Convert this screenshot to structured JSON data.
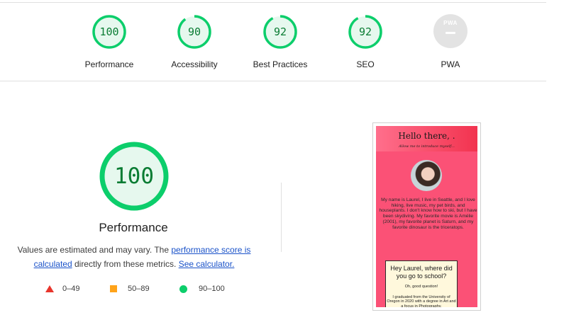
{
  "categories": [
    {
      "label": "Performance",
      "score": "100",
      "fraction": 1.0
    },
    {
      "label": "Accessibility",
      "score": "90",
      "fraction": 0.9
    },
    {
      "label": "Best Practices",
      "score": "92",
      "fraction": 0.92
    },
    {
      "label": "SEO",
      "score": "92",
      "fraction": 0.92
    },
    {
      "label": "PWA",
      "badge_text": "PWA"
    }
  ],
  "main": {
    "score": "100",
    "fraction": 1.0,
    "title": "Performance",
    "desc_prefix": "Values are estimated and may vary. The ",
    "desc_link1": "performance score is calculated",
    "desc_middle": " directly from these metrics. ",
    "desc_link2": "See calculator.",
    "legend": [
      {
        "range": "0–49",
        "icon": "red-triangle-icon",
        "color": "#e8352c"
      },
      {
        "range": "50–89",
        "icon": "orange-square-icon",
        "color": "#ffa31a"
      },
      {
        "range": "90–100",
        "icon": "green-circle-icon",
        "color": "#0cce6b"
      }
    ]
  },
  "colors": {
    "pass_ring": "#0cce6b",
    "pass_text": "#0a7c33",
    "pass_fill": "#e6f8ee",
    "link": "#1a52c9"
  },
  "preview": {
    "heading": "Hello there, .",
    "subheading": "Allow me to introduce myself...",
    "bio": "My name is Laurel, I live in Seattle, and I love hiking, live music, my pet birds, and houseplants. I don't know how to ski, but I have been skydiving. My favorite movie is Amélie (2001), my favorite planet is Saturn, and my favorite dinosaur is the triceratops.",
    "card_question": "Hey Laurel, where did you go to school?",
    "card_answer1": "Oh, good question!",
    "card_answer2": "I graduated from the University of Oregon in 2020 with a degree in Art and a focus in Photography."
  }
}
